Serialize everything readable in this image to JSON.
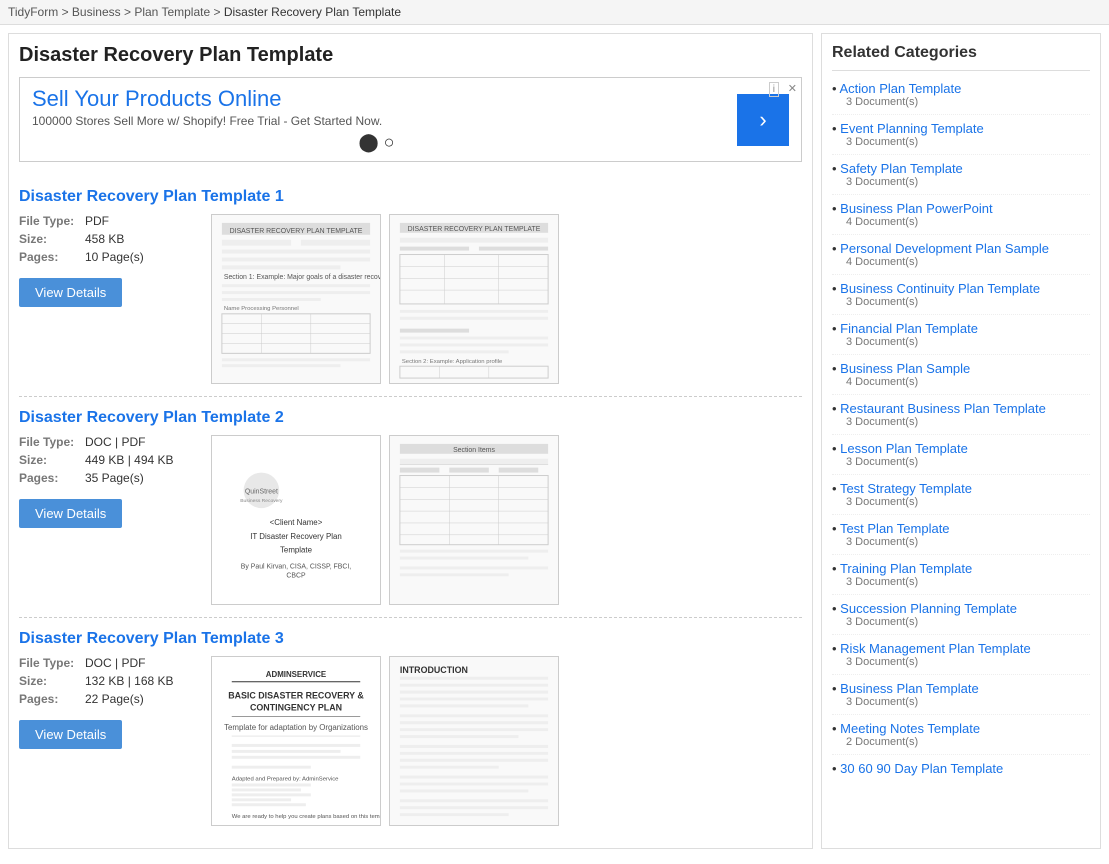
{
  "breadcrumb": {
    "items": [
      "TidyForm",
      "Business",
      "Plan Template"
    ],
    "current": "Disaster Recovery Plan Template"
  },
  "page": {
    "title": "Disaster Recovery Plan Template"
  },
  "ad": {
    "label": "i",
    "headline": "Sell Your Products Online",
    "subtext": "100000 Stores Sell More w/ Shopify! Free Trial - Get Started Now.",
    "arrow": "›"
  },
  "templates": [
    {
      "title": "Disaster Recovery Plan Template 1",
      "fileType": "PDF",
      "size": "458 KB",
      "pages": "10 Page(s)",
      "buttonLabel": "View Details"
    },
    {
      "title": "Disaster Recovery Plan Template 2",
      "fileType": "DOC | PDF",
      "size": "449 KB | 494 KB",
      "pages": "35 Page(s)",
      "buttonLabel": "View Details"
    },
    {
      "title": "Disaster Recovery Plan Template 3",
      "fileType": "DOC | PDF",
      "size": "132 KB | 168 KB",
      "pages": "22 Page(s)",
      "buttonLabel": "View Details"
    }
  ],
  "sidebar": {
    "title": "Related Categories",
    "items": [
      {
        "label": "Action Plan Template",
        "count": "3 Document(s)"
      },
      {
        "label": "Event Planning Template",
        "count": "3 Document(s)"
      },
      {
        "label": "Safety Plan Template",
        "count": "3 Document(s)"
      },
      {
        "label": "Business Plan PowerPoint",
        "count": "4 Document(s)"
      },
      {
        "label": "Personal Development Plan Sample",
        "count": "4 Document(s)"
      },
      {
        "label": "Business Continuity Plan Template",
        "count": "3 Document(s)"
      },
      {
        "label": "Financial Plan Template",
        "count": "3 Document(s)"
      },
      {
        "label": "Business Plan Sample",
        "count": "4 Document(s)"
      },
      {
        "label": "Restaurant Business Plan Template",
        "count": "3 Document(s)"
      },
      {
        "label": "Lesson Plan Template",
        "count": "3 Document(s)"
      },
      {
        "label": "Test Strategy Template",
        "count": "3 Document(s)"
      },
      {
        "label": "Test Plan Template",
        "count": "3 Document(s)"
      },
      {
        "label": "Training Plan Template",
        "count": "3 Document(s)"
      },
      {
        "label": "Succession Planning Template",
        "count": "3 Document(s)"
      },
      {
        "label": "Risk Management Plan Template",
        "count": "3 Document(s)"
      },
      {
        "label": "Business Plan Template",
        "count": "3 Document(s)"
      },
      {
        "label": "Meeting Notes Template",
        "count": "2 Document(s)"
      },
      {
        "label": "30 60 90 Day Plan Template",
        "count": ""
      }
    ]
  }
}
